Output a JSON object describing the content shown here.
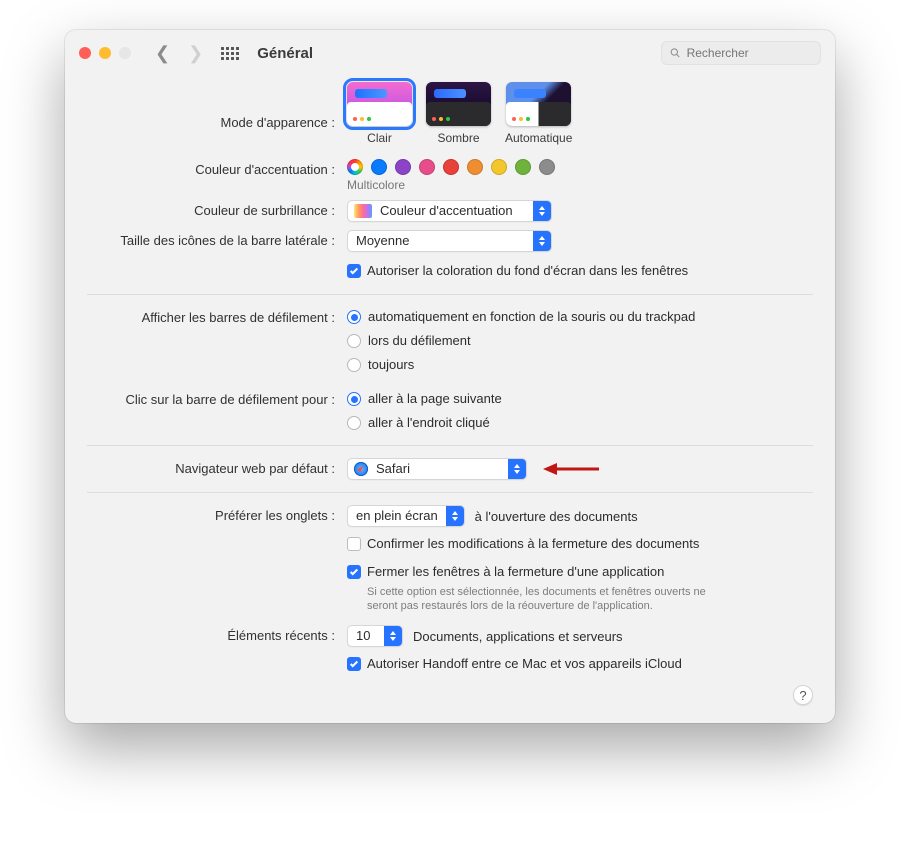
{
  "titlebar": {
    "title": "Général",
    "search_placeholder": "Rechercher"
  },
  "appearance": {
    "label": "Mode d'apparence :",
    "options": [
      {
        "id": "light",
        "label": "Clair",
        "selected": true
      },
      {
        "id": "dark",
        "label": "Sombre",
        "selected": false
      },
      {
        "id": "auto",
        "label": "Automatique",
        "selected": false
      }
    ]
  },
  "accent": {
    "label": "Couleur d'accentuation :",
    "caption": "Multicolore",
    "colors": [
      {
        "name": "multicolor",
        "hex": "multi",
        "selected": true
      },
      {
        "name": "blue",
        "hex": "#0a7aff"
      },
      {
        "name": "purple",
        "hex": "#8b44c7"
      },
      {
        "name": "pink",
        "hex": "#e74d8b"
      },
      {
        "name": "red",
        "hex": "#e7413a"
      },
      {
        "name": "orange",
        "hex": "#ef8d31"
      },
      {
        "name": "yellow",
        "hex": "#f3c62c"
      },
      {
        "name": "green",
        "hex": "#6fb33c"
      },
      {
        "name": "graphite",
        "hex": "#8c8c8c"
      }
    ]
  },
  "highlight": {
    "label": "Couleur de surbrillance :",
    "value": "Couleur d'accentuation"
  },
  "sidebar_size": {
    "label": "Taille des icônes de la barre latérale :",
    "value": "Moyenne"
  },
  "tint_checkbox": {
    "label": "Autoriser la coloration du fond d'écran dans les fenêtres",
    "checked": true
  },
  "scrollbars": {
    "label": "Afficher les barres de défilement :",
    "options": [
      {
        "label": "automatiquement en fonction de la souris ou du trackpad",
        "selected": true
      },
      {
        "label": "lors du défilement",
        "selected": false
      },
      {
        "label": "toujours",
        "selected": false
      }
    ]
  },
  "scroll_click": {
    "label": "Clic sur la barre de défilement pour :",
    "options": [
      {
        "label": "aller à la page suivante",
        "selected": true
      },
      {
        "label": "aller à l'endroit cliqué",
        "selected": false
      }
    ]
  },
  "browser": {
    "label": "Navigateur web par défaut :",
    "value": "Safari"
  },
  "tabs": {
    "label": "Préférer les onglets :",
    "value": "en plein écran",
    "suffix": "à l'ouverture des documents"
  },
  "confirm_changes": {
    "label": "Confirmer les modifications à la fermeture des documents",
    "checked": false
  },
  "close_windows": {
    "label": "Fermer les fenêtres à la fermeture d'une application",
    "checked": true,
    "hint": "Si cette option est sélectionnée, les documents et fenêtres ouverts ne seront pas restaurés lors de la réouverture de l'application."
  },
  "recent": {
    "label": "Éléments récents :",
    "value": "10",
    "suffix": "Documents, applications et serveurs"
  },
  "handoff": {
    "label": "Autoriser Handoff entre ce Mac et vos appareils iCloud",
    "checked": true
  },
  "help": "?"
}
